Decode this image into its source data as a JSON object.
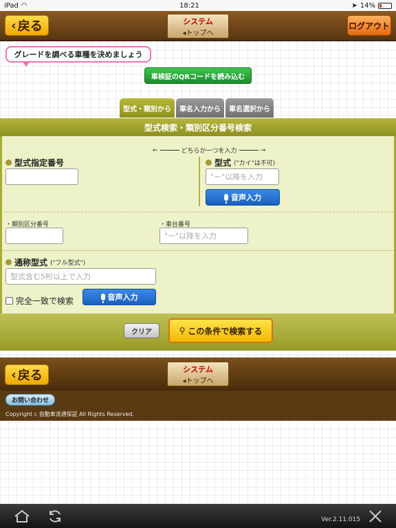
{
  "status": {
    "device": "iPad",
    "time": "18:21",
    "battery": "14%"
  },
  "header": {
    "back_label": "戻る",
    "logo_top": "システム",
    "logo_bottom": "◂トップへ",
    "logout_label": "ログアウト"
  },
  "bubble": {
    "text": "グレードを調べる車種を決めましょう"
  },
  "qr_button": {
    "label": "車検証のQRコードを読み込む"
  },
  "tabs": [
    {
      "label": "型式・類別から"
    },
    {
      "label": "車名入力から"
    },
    {
      "label": "車名選択から"
    }
  ],
  "panel": {
    "title": "型式検索・類別区分番号検索",
    "hint": "どちらか一つを入力",
    "model_designation": {
      "label": "型式指定番号",
      "value": ""
    },
    "model_type": {
      "label": "型式",
      "note": "(\"カイ\"は不可)",
      "placeholder": "\"ー\"以降を入力",
      "voice_label": "音声入力"
    },
    "category_number": {
      "label": "・類別区分番号",
      "value": ""
    },
    "chassis_number": {
      "label": "・車台番号",
      "placeholder": "\"ー\"以降を入力"
    },
    "common_model": {
      "label": "通称型式",
      "note": "(\"フル型式\")",
      "placeholder": "型式含む5桁以上で入力",
      "voice_label": "音声入力"
    },
    "exact_match_label": "完全一致で検索"
  },
  "actions": {
    "clear_label": "クリア",
    "search_label": "この条件で検索する"
  },
  "footer": {
    "back_label": "戻る",
    "logo_top": "システム",
    "logo_bottom": "◂トップへ",
    "contact_label": "お問い合わせ",
    "copyright": "Copyright c 自動車流通保証 All Rights Reserved."
  },
  "bottom_bar": {
    "version": "Ver.2.11.015"
  },
  "colors": {
    "header_brown": "#6b4515",
    "olive": "#a9ab34",
    "gold": "#f5b800",
    "green": "#1f8b2d",
    "blue": "#1a5fbf"
  }
}
